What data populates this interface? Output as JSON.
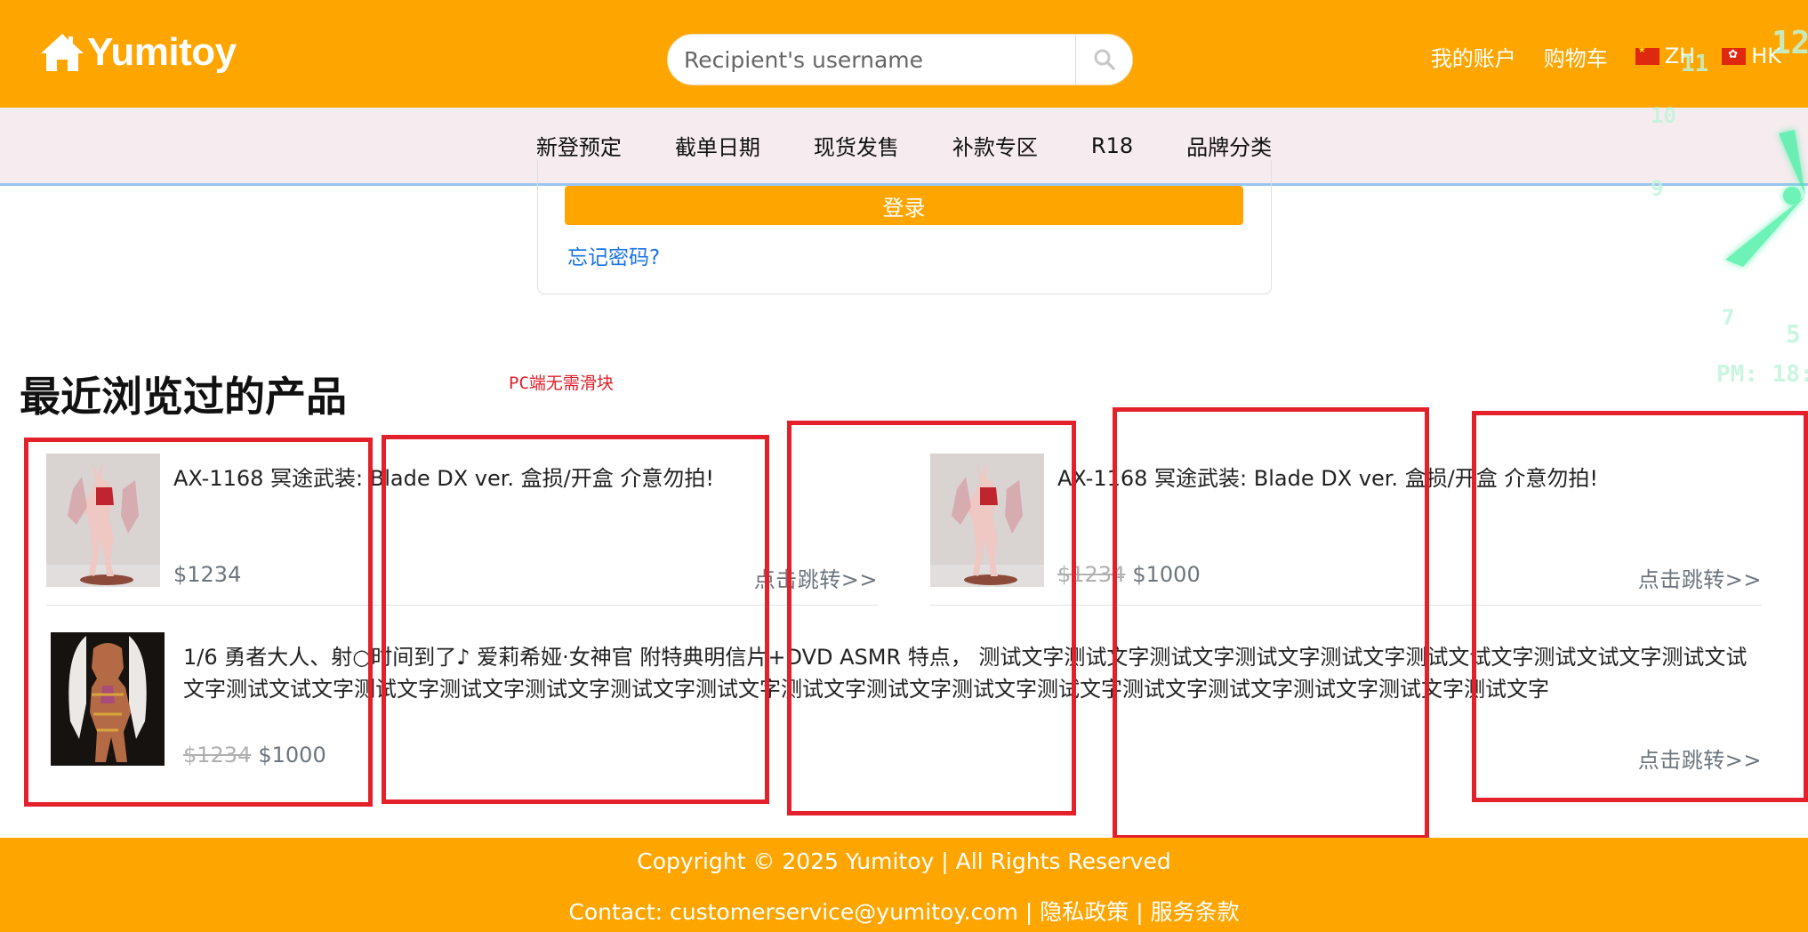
{
  "header": {
    "logo_text": "Yumitoy",
    "search_placeholder": "Recipient's username",
    "links": {
      "account": "我的账户",
      "cart": "购物车",
      "lang_zh": "ZH",
      "lang_hk": "HK"
    }
  },
  "nav": {
    "items": [
      "新登预定",
      "截单日期",
      "现货发售",
      "补款专区",
      "R18",
      "品牌分类"
    ]
  },
  "login": {
    "button_label": "登录",
    "forgot_label": "忘记密码?"
  },
  "recent": {
    "title": "最近浏览过的产品",
    "note": "PC端无需滑块",
    "products": [
      {
        "title": "AX-1168 冥途武装: Blade DX ver. 盒损/开盒 介意勿拍!",
        "old_price": "",
        "price": "$1234",
        "link": "点击跳转>>"
      },
      {
        "title": "AX-1168 冥途武装: Blade DX ver. 盒损/开盒 介意勿拍!",
        "old_price": "$1234",
        "price": "$1000",
        "link": "点击跳转>>"
      },
      {
        "title": "1/6 勇者大人、射○时间到了♪ 爱莉希娅·女神官 附特典明信片+DVD ASMR 特点， 测试文字测试文字测试文字测试文字测试文字测试文试文字测试文试文字测试文试文字测试文试文字测试文字测试文字测试文字测试文字测试文字测试文字测试文字测试文字测试文字测试文字测试文字测试文字测试文字测试文字",
        "old_price": "$1234",
        "price": "$1000",
        "link": "点击跳转>>"
      }
    ]
  },
  "footer": {
    "copyright": "Copyright © 2025 Yumitoy | All Rights Reserved",
    "contact": "Contact: customerservice@yumitoy.com",
    "privacy": "隐私政策",
    "terms": "服务条款",
    "separator": "|"
  },
  "clock": {
    "numbers": [
      "12",
      "11",
      "10",
      "9",
      "7",
      "5"
    ],
    "pm_text": "PM: 18:"
  },
  "colors": {
    "brand": "#ffa500",
    "nav_bg": "#f6ebee",
    "link_blue": "#1a73e8",
    "overlay_red": "#e4212b",
    "clock_green": "#3cf0a0"
  }
}
